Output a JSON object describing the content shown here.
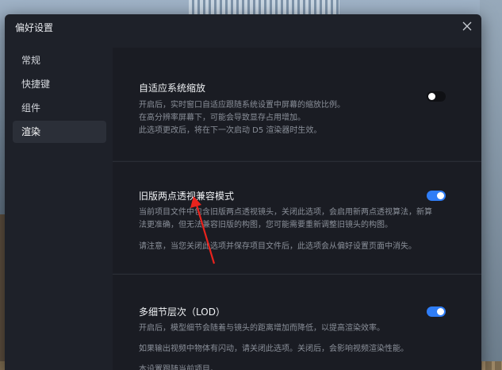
{
  "window": {
    "title": "偏好设置"
  },
  "sidebar": {
    "items": [
      {
        "label": "常规"
      },
      {
        "label": "快捷键"
      },
      {
        "label": "组件"
      },
      {
        "label": "渲染"
      }
    ]
  },
  "sections": {
    "adaptive_scaling": {
      "title": "自适应系统缩放",
      "desc": [
        "开启后，实时窗口自适应跟随系统设置中屏幕的缩放比例。",
        "在高分辨率屏幕下，可能会导致显存占用增加。",
        "此选项更改后，将在下一次启动 D5 渲染器时生效。"
      ],
      "enabled": false
    },
    "legacy_two_point": {
      "title": "旧版两点透视兼容模式",
      "desc": [
        "当前项目文件中包含旧版两点透视镜头，关闭此选项，会启用新两点透视算法，新算",
        "法更准确，但无法兼容旧版的构图，您可能需要重新调整旧镜头的构图。"
      ],
      "note": "请注意，当您关闭此选项并保存项目文件后，此选项会从偏好设置页面中消失。",
      "enabled": true
    },
    "lod": {
      "title": "多细节层次（LOD）",
      "desc": "开启后，模型细节会随着与镜头的距离增加而降低，以提高渲染效率。",
      "note": "如果输出视频中物体有闪动，请关闭此选项。关闭后，会影响视频渲染性能。",
      "note2": "本设置跟随当前项目。",
      "enabled": true
    }
  },
  "colors": {
    "accent": "#2f7df6",
    "annotation_arrow": "#e8231d"
  },
  "icons": {
    "close": "close-icon"
  }
}
